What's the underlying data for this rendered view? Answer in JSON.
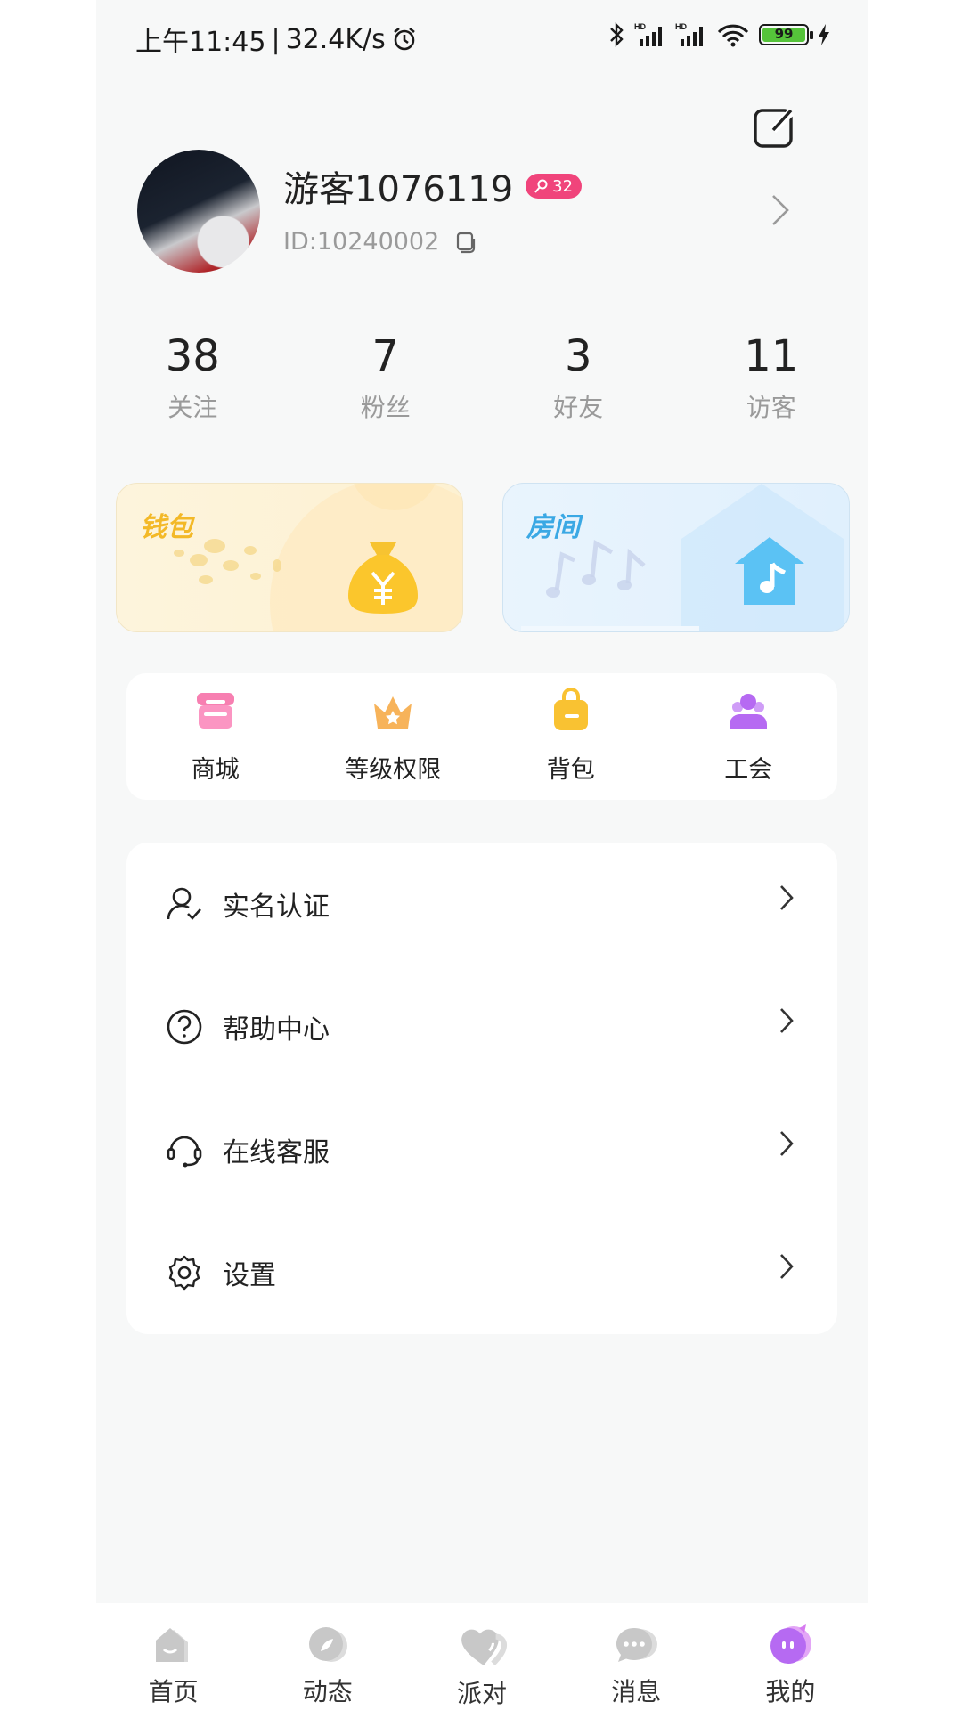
{
  "status_bar": {
    "time": "上午11:45",
    "net_speed": "32.4K/s",
    "battery": "99",
    "icons": [
      "alarm-icon",
      "bluetooth-icon",
      "signal-icon",
      "wifi-icon",
      "battery-icon",
      "charging-icon"
    ]
  },
  "profile": {
    "username": "游客1076119",
    "level": "32",
    "user_id": "ID:10240002"
  },
  "stats": [
    {
      "value": "38",
      "label": "关注"
    },
    {
      "value": "7",
      "label": "粉丝"
    },
    {
      "value": "3",
      "label": "好友"
    },
    {
      "value": "11",
      "label": "访客"
    }
  ],
  "cards": {
    "wallet": "钱包",
    "room": "房间"
  },
  "quick": [
    {
      "label": "商城",
      "icon": "shop-icon",
      "color": "#f77fb1"
    },
    {
      "label": "等级权限",
      "icon": "crown-icon",
      "color": "#f7b35a"
    },
    {
      "label": "背包",
      "icon": "backpack-icon",
      "color": "#f9c232"
    },
    {
      "label": "工会",
      "icon": "guild-icon",
      "color": "#b66af2"
    }
  ],
  "menu": [
    {
      "label": "实名认证",
      "icon": "user-verify-icon"
    },
    {
      "label": "帮助中心",
      "icon": "help-icon"
    },
    {
      "label": "在线客服",
      "icon": "headset-icon"
    },
    {
      "label": "设置",
      "icon": "gear-icon"
    }
  ],
  "tabs": [
    {
      "label": "首页",
      "icon": "home-icon"
    },
    {
      "label": "动态",
      "icon": "moment-icon"
    },
    {
      "label": "派对",
      "icon": "party-icon"
    },
    {
      "label": "消息",
      "icon": "message-icon"
    },
    {
      "label": "我的",
      "icon": "mine-icon"
    }
  ],
  "colors": {
    "accent": "#b66af2",
    "badge": "#f0447b",
    "page_bg": "#f7f8f8"
  }
}
